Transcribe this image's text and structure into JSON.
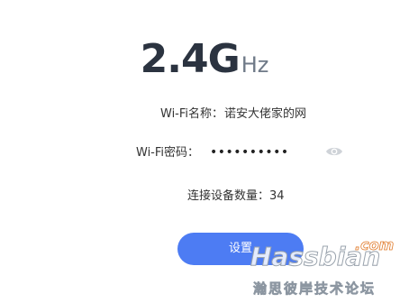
{
  "band": {
    "frequency_value": "2.4G",
    "frequency_unit": "Hz"
  },
  "wifi": {
    "ssid_label": "Wi-Fi名称：",
    "ssid_value": "诺安大佬家的网",
    "password_label": "Wi-Fi密码：",
    "password_masked": "••••••••••",
    "connected_label": "连接设备数量：",
    "connected_count": "34"
  },
  "actions": {
    "settings_label": "设置"
  },
  "icons": {
    "show_password": "eye-icon"
  },
  "colors": {
    "primary": "#4d7cf3",
    "heading": "#2b3340",
    "unit": "#6f7a88"
  },
  "watermark": {
    "site": "Hassbian",
    "domain_suffix": ".com",
    "forum_name": "瀚思彼岸技术论坛"
  }
}
